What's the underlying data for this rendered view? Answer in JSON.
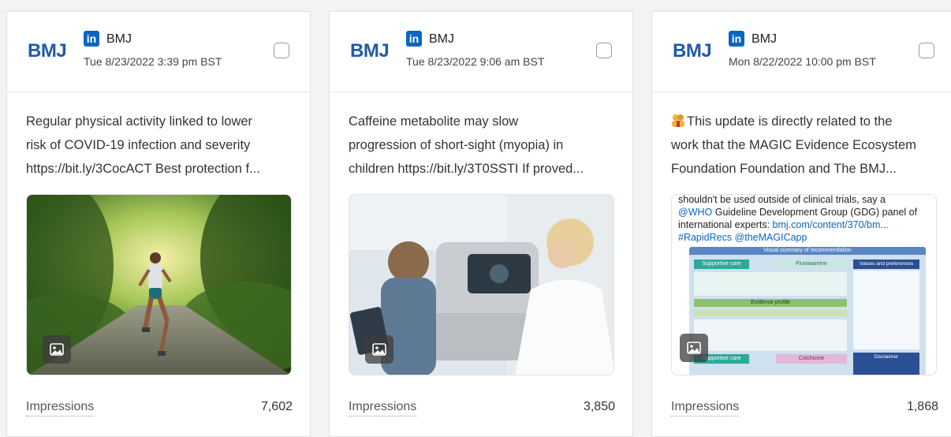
{
  "posts": [
    {
      "brand": "BMJ",
      "network_icon": "linkedin-icon",
      "account": "BMJ",
      "date": "Tue 8/23/2022 3:39 pm BST",
      "text_lines": [
        "Regular physical activity linked to lower",
        "risk of COVID-19 infection and severity",
        "https://bit.ly/3CocACT Best protection f..."
      ],
      "media_icon": "image-icon",
      "metric_label": "Impressions",
      "metric_value": "7,602"
    },
    {
      "brand": "BMJ",
      "network_icon": "linkedin-icon",
      "account": "BMJ",
      "date": "Tue 8/23/2022 9:06 am BST",
      "text_lines": [
        "Caffeine metabolite may slow",
        "progression of short-sight (myopia) in",
        "children https://bit.ly/3T0SSTI If proved..."
      ],
      "media_icon": "image-icon",
      "metric_label": "Impressions",
      "metric_value": "3,850"
    },
    {
      "brand": "BMJ",
      "network_icon": "linkedin-icon",
      "account": "BMJ",
      "date": "Mon 8/22/2022 10:00 pm BST",
      "text_lines": [
        "This update is directly related to the",
        "work that the MAGIC Evidence Ecosystem",
        "Foundation Foundation and The BMJ..."
      ],
      "media_icon": "image-icon",
      "media_text": {
        "line1": "shouldn't be used outside of clinical trials, say a",
        "line2_link": "@WHO",
        "line2_rest": " Guideline Development Group (GDG) panel of",
        "line3_a": "international experts: ",
        "line3_link": "bmj.com/content/370/bm...",
        "line4_link": "#RapidRecs @theMAGICapp",
        "infographic_title": "Visual summary of recommendation",
        "col_supportive": "Supportive care",
        "col_fluvox": "Fluvoxamine",
        "col_values": "Values and preferences",
        "evidence_profile": "Evidence profile",
        "col_colchicine": "Colchicine",
        "disclaimer": "Disclaimer"
      },
      "metric_label": "Impressions",
      "metric_value": "1,868"
    }
  ],
  "colors": {
    "brand_blue": "#1f5ba7",
    "linkedin_blue": "#0a66c2"
  }
}
